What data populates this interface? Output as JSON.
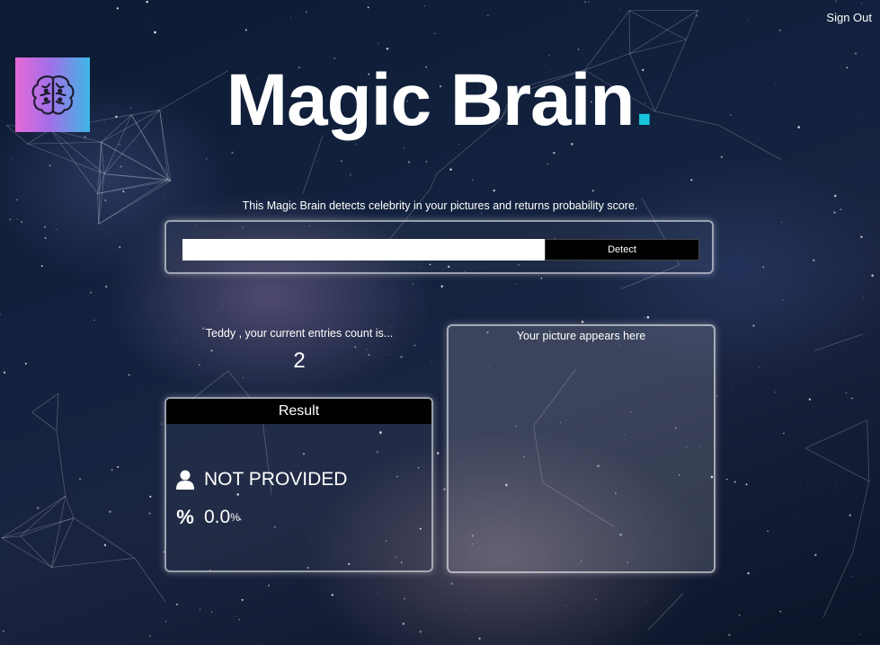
{
  "header": {
    "sign_out_label": "Sign Out",
    "logo_icon": "brain-icon"
  },
  "title": {
    "text": "Magic Brain",
    "dot": ".",
    "dot_color": "#17c5dc"
  },
  "description": "This Magic Brain detects celebrity in your pictures and returns probability score.",
  "form": {
    "input_value": "",
    "detect_label": "Detect"
  },
  "entries": {
    "text": "Teddy , your current entries count is...",
    "count": "2"
  },
  "result": {
    "header": "Result",
    "name": "NOT PROVIDED",
    "name_icon": "user-icon",
    "probability": "0.0",
    "probability_unit": "%",
    "probability_icon": "percent-icon"
  },
  "picture": {
    "placeholder": "Your picture appears here"
  }
}
